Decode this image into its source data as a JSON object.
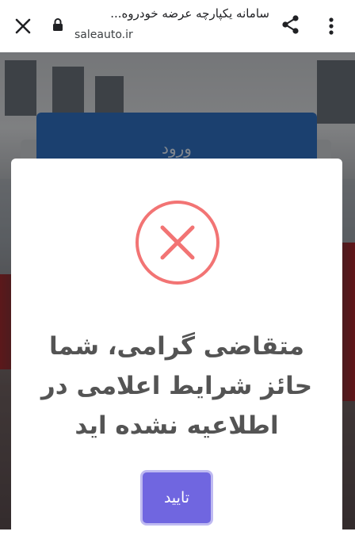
{
  "browser": {
    "title": "سامانه یکپارچه عرضه خودروه...",
    "url": "saleauto.ir",
    "close_icon": "close-icon",
    "lock_icon": "lock-icon",
    "share_icon": "share-icon",
    "menu_icon": "more-vert-icon"
  },
  "background_page": {
    "banner_text": "ورود"
  },
  "modal": {
    "icon": "error-x-icon",
    "icon_color": "#f27474",
    "message": "متقاضی گرامی، شما حائز شرایط اعلامی در اطلاعیه نشده اید",
    "confirm_label": "تایید",
    "confirm_color": "#7066e0"
  }
}
